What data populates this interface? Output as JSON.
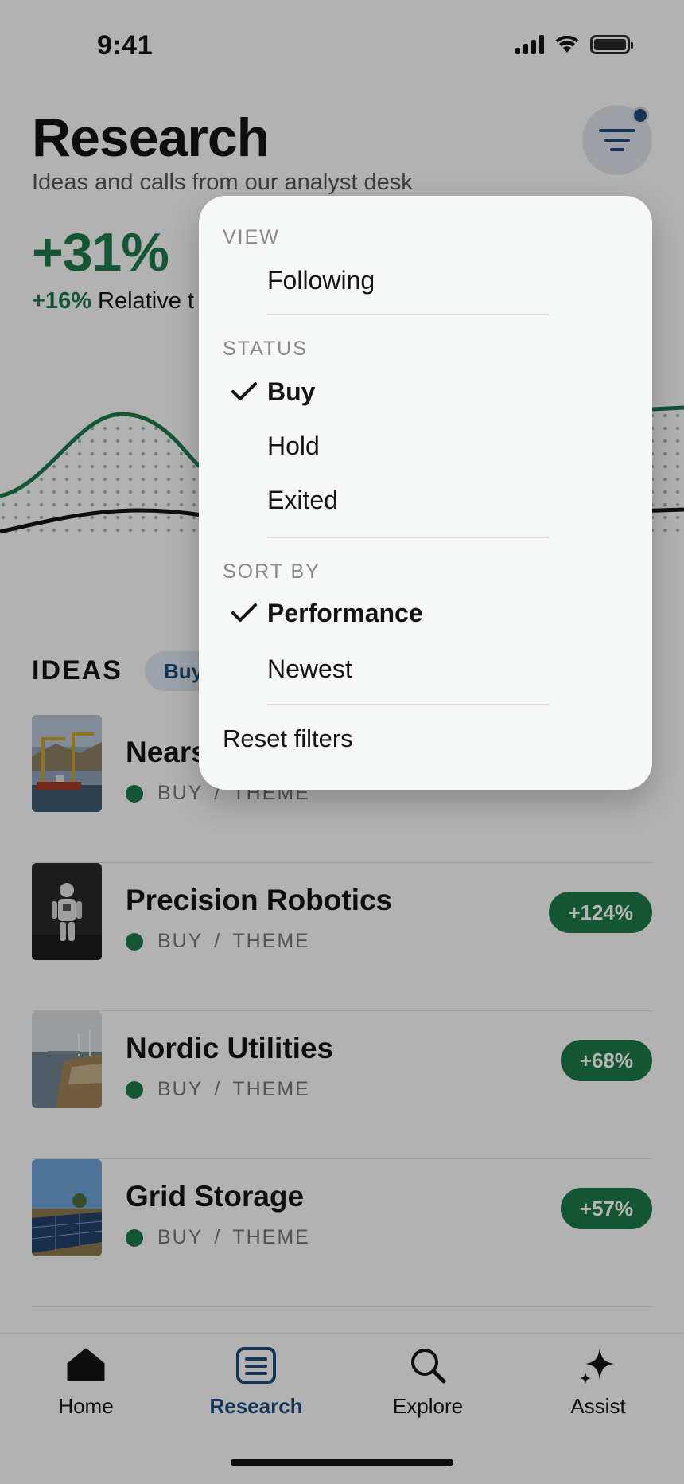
{
  "status_bar": {
    "time": "9:41"
  },
  "header": {
    "title": "Research",
    "subtitle": "Ideas and calls from our analyst desk",
    "performance": "+31%",
    "relative_value": "+16%",
    "relative_label": "Relative t"
  },
  "ideas": {
    "title": "IDEAS",
    "chip": "Buy",
    "items": [
      {
        "name": "Nears",
        "status": "BUY",
        "separator": "/",
        "category": "THEME",
        "return": ""
      },
      {
        "name": "Precision Robotics",
        "status": "BUY",
        "separator": "/",
        "category": "THEME",
        "return": "+124%"
      },
      {
        "name": "Nordic Utilities",
        "status": "BUY",
        "separator": "/",
        "category": "THEME",
        "return": "+68%"
      },
      {
        "name": "Grid Storage",
        "status": "BUY",
        "separator": "/",
        "category": "THEME",
        "return": "+57%"
      }
    ]
  },
  "filter_menu": {
    "view": {
      "label": "VIEW",
      "items": [
        "Following"
      ]
    },
    "status": {
      "label": "STATUS",
      "items": [
        "Buy",
        "Hold",
        "Exited"
      ],
      "selected": "Buy"
    },
    "sort": {
      "label": "SORT BY",
      "items": [
        "Performance",
        "Newest"
      ],
      "selected": "Performance"
    },
    "reset": "Reset filters"
  },
  "tabs": [
    {
      "label": "Home",
      "icon": "home-icon"
    },
    {
      "label": "Research",
      "icon": "research-icon",
      "active": true
    },
    {
      "label": "Explore",
      "icon": "search-icon"
    },
    {
      "label": "Assist",
      "icon": "sparkle-icon"
    }
  ],
  "colors": {
    "accent_green": "#1d7a4a",
    "accent_blue": "#1f4b7a"
  }
}
